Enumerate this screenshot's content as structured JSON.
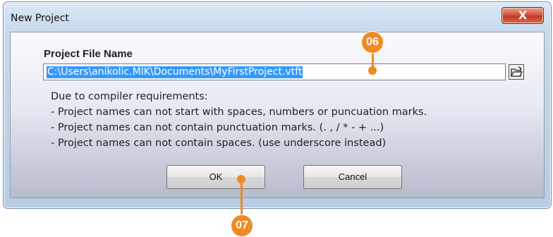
{
  "dialog": {
    "title": "New Project",
    "close_glyph": "X",
    "project_file_label": "Project File Name",
    "project_path": "C:\\Users\\anikolic.MIK\\Documents\\MyFirstProject.vtft",
    "browse_icon": "folder-icon",
    "notes": [
      "Due to compiler requirements:",
      " - Project names can not start with spaces, numbers or puncuation marks.",
      " - Project names can not contain punctuation marks. (.  ,  /  *  -  + ...)",
      " - Project names can not contain spaces. (use underscore instead)"
    ],
    "ok_label": "OK",
    "cancel_label": "Cancel"
  },
  "callouts": {
    "c06": "06",
    "c07": "07",
    "color": "#f08a24"
  }
}
